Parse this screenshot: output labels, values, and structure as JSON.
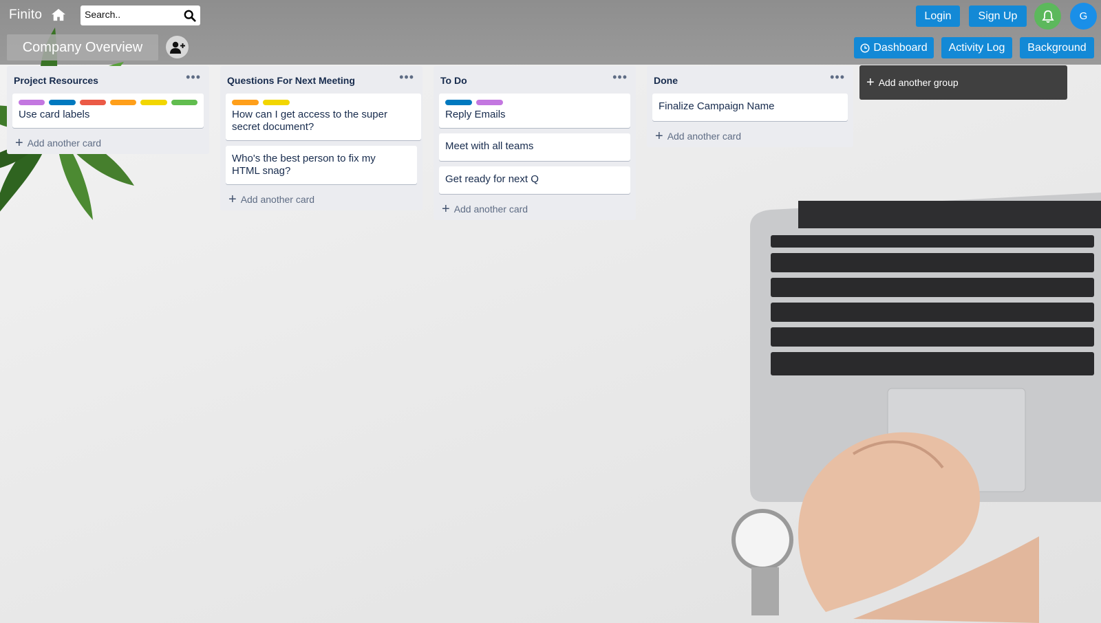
{
  "app": {
    "brand": "Finito"
  },
  "search": {
    "placeholder": "Search.."
  },
  "auth": {
    "login_label": "Login",
    "signup_label": "Sign Up",
    "avatar_initial": "G"
  },
  "board": {
    "title": "Company Overview",
    "nav": {
      "dashboard_label": "Dashboard",
      "activity_label": "Activity Log",
      "background_label": "Background"
    }
  },
  "colors": {
    "accent_blue": "#1389d6",
    "bell_green": "#5cb85c",
    "avatar_blue": "#1a8fe8",
    "label_purple": "#c377e0",
    "label_blue": "#0079bf",
    "label_red": "#eb5a46",
    "label_orange": "#ff9f1a",
    "label_yellow": "#f2d600",
    "label_green": "#61bd4f"
  },
  "lists": [
    {
      "title": "Project Resources",
      "add_card_label": "Add another card",
      "cards": [
        {
          "text": "Use card labels",
          "labels": [
            "purple",
            "blue",
            "red",
            "orange",
            "yellow",
            "green"
          ]
        }
      ]
    },
    {
      "title": "Questions For Next Meeting",
      "add_card_label": "Add another card",
      "cards": [
        {
          "text": "How can I get access to the super secret document?",
          "labels": [
            "orange",
            "yellow"
          ]
        },
        {
          "text": "Who's the best person to fix my HTML snag?",
          "labels": []
        }
      ]
    },
    {
      "title": "To Do",
      "add_card_label": "Add another card",
      "cards": [
        {
          "text": "Reply Emails",
          "labels": [
            "blue",
            "purple"
          ]
        },
        {
          "text": "Meet with all teams",
          "labels": []
        },
        {
          "text": "Get ready for next Q",
          "labels": []
        }
      ]
    },
    {
      "title": "Done",
      "add_card_label": "Add another card",
      "cards": [
        {
          "text": "Finalize Campaign Name",
          "labels": []
        }
      ]
    }
  ],
  "add_group_label": "Add another group",
  "icons": [
    "home-icon",
    "search-icon",
    "bell-icon",
    "add-user-icon",
    "clock-icon",
    "more-icon",
    "plus-icon"
  ]
}
